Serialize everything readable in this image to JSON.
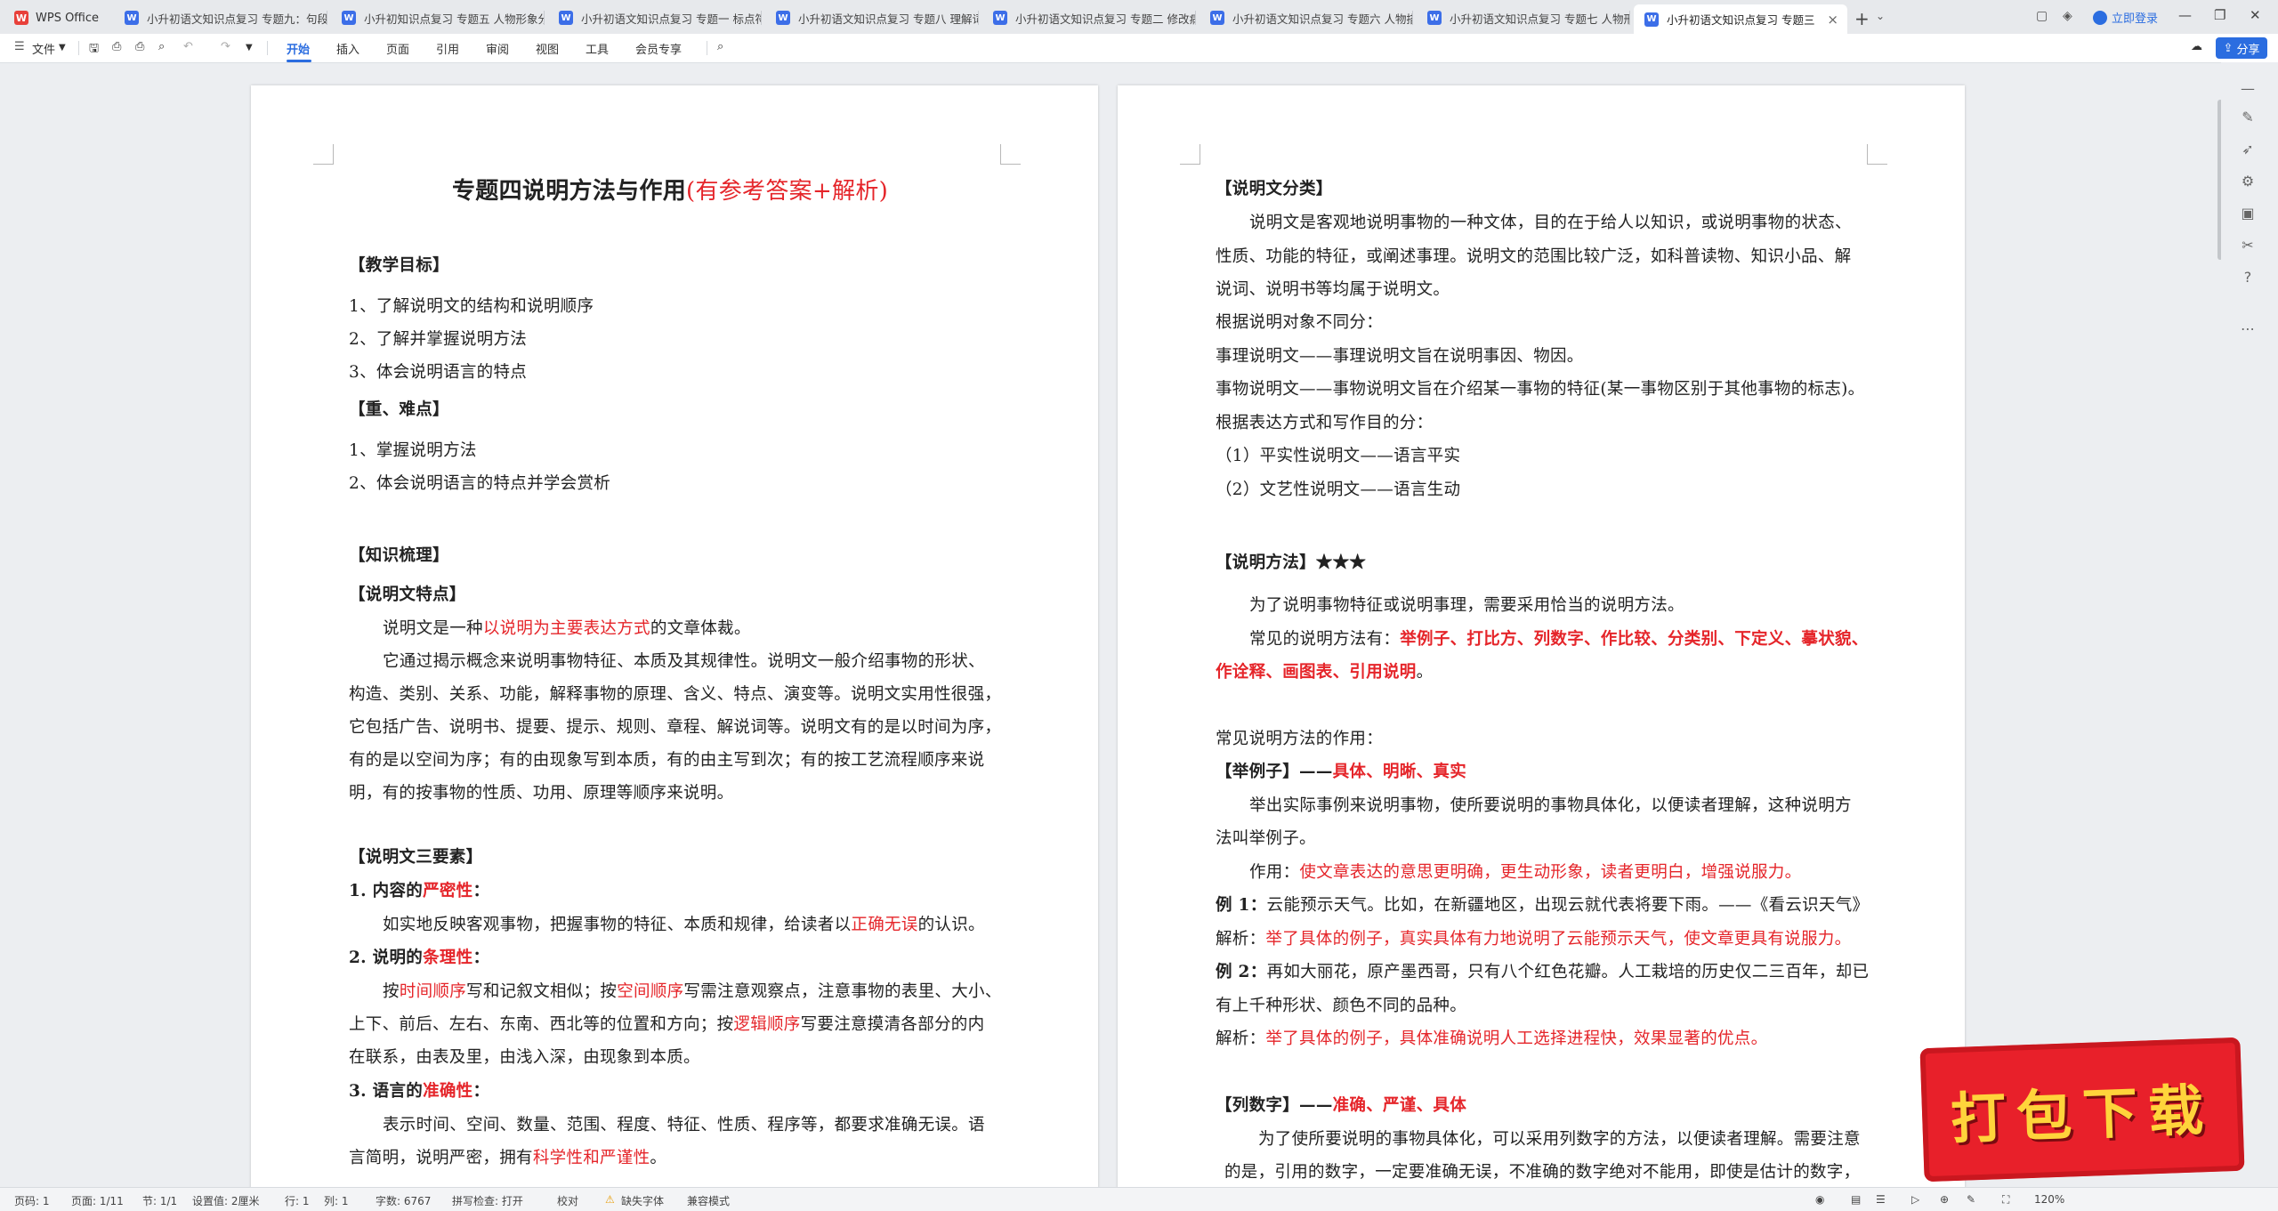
{
  "app": {
    "home_label": "WPS Office",
    "logo_letter": "W",
    "login_label": "立即登录",
    "share_label": "分享"
  },
  "tabs": [
    {
      "title": "小升初语文知识点复习 专题九：句段"
    },
    {
      "title": "小升初知识点复习 专题五 人物形象分析"
    },
    {
      "title": "小升初语文知识点复习 专题一 标点符号"
    },
    {
      "title": "小升初语文知识点复习 专题八 理解词语"
    },
    {
      "title": "小升初语文知识点复习 专题二 修改病句"
    },
    {
      "title": "小升初语文知识点复习 专题六 人物描写"
    },
    {
      "title": "小升初语文知识点复习 专题七 人物形象"
    },
    {
      "title": "小升初语文知识点复习 专题三"
    }
  ],
  "ribbon": {
    "file_label": "文件",
    "tabs": [
      "开始",
      "插入",
      "页面",
      "引用",
      "审阅",
      "视图",
      "工具",
      "会员专享"
    ]
  },
  "page1": {
    "title_main": "专题四说明方法与作用",
    "title_red": "(有参考答案+解析)",
    "goal_heading": "【教学目标】",
    "goals": [
      "1、了解说明文的结构和说明顺序",
      "2、了解并掌握说明方法",
      "3、体会说明语言的特点"
    ],
    "key_heading": "【重、难点】",
    "keys": [
      "1、掌握说明方法",
      "2、体会说明语言的特点并学会赏析"
    ],
    "knowledge_heading": "【知识梳理】",
    "feature_heading": "【说明文特点】",
    "feature_p1_a": "说明文是一种",
    "feature_p1_red": "以说明为主要表达方式",
    "feature_p1_b": "的文章体裁。",
    "feature_lines": [
      "它通过揭示概念来说明事物特征、本质及其规律性。说明文一般介绍事物的形状、",
      "构造、类别、关系、功能，解释事物的原理、含义、特点、演变等。说明文实用性很强，",
      "它包括广告、说明书、提要、提示、规则、章程、解说词等。说明文有的是以时间为序，",
      "有的是以空间为序；有的由现象写到本质，有的由主写到次；有的按工艺流程顺序来说",
      "明，有的按事物的性质、功用、原理等顺序来说明。"
    ],
    "three_heading": "【说明文三要素】",
    "r1_label": "1. 内容的",
    "r1_red": "严密性",
    "r1_colon": "：",
    "r1_text_a": "如实地反映客观事物，把握事物的特征、本质和规律，给读者以",
    "r1_text_red": "正确无误",
    "r1_text_b": "的认识。",
    "r2_label": "2. 说明的",
    "r2_red": "条理性",
    "r2_colon": "：",
    "r2_l1_a": "按",
    "r2_l1_r1": "时间顺序",
    "r2_l1_b": "写和记叙文相似；按",
    "r2_l1_r2": "空间顺序",
    "r2_l1_c": "写需注意观察点，注意事物的表里、大小、",
    "r2_l2_a": "上下、前后、左右、东南、西北等的位置和方向；按",
    "r2_l2_r": "逻辑顺序",
    "r2_l2_b": "写要注意摸清各部分的内",
    "r2_l3": "在联系，由表及里，由浅入深，由现象到本质。",
    "r3_label": "3. 语言的",
    "r3_red": "准确性",
    "r3_colon": "：",
    "r3_l1": "表示时间、空间、数量、范围、程度、特征、性质、程序等，都要求准确无误。语",
    "r3_l2_a": "言简明，说明严密，拥有",
    "r3_l2_red": "科学性和严谨性",
    "r3_l2_b": "。"
  },
  "page2": {
    "class_heading": "【说明文分类】",
    "class_lines": [
      "说明文是客观地说明事物的一种文体，目的在于给人以知识，或说明事物的状态、",
      "性质、功能的特征，或阐述事理。说明文的范围比较广泛，如科普读物、知识小品、解",
      "说词、说明书等均属于说明文。",
      "根据说明对象不同分：",
      "事理说明文——事理说明文旨在说明事因、物因。",
      "事物说明文——事物说明文旨在介绍某一事物的特征(某一事物区别于其他事物的标志)。",
      "根据表达方式和写作目的分：",
      "（1）平实性说明文——语言平实",
      "（2）文艺性说明文——语言生动"
    ],
    "method_heading": "【说明方法】★★★",
    "method_p1": "为了说明事物特征或说明事理，需要采用恰当的说明方法。",
    "method_p2_a": "常见的说明方法有：",
    "method_p2_red": "举例子、打比方、列数字、作比较、分类别、下定义、摹状貌、",
    "method_p3_red": "作诠释、画图表、引用说明",
    "method_p3_b": "。",
    "effect_heading": "常见说明方法的作用：",
    "eg_heading": "【举例子】",
    "eg_dash": "——",
    "eg_red": "具体、明晰、真实",
    "eg_l1": "举出实际事例来说明事物，使所要说明的事物具体化，以便读者理解，这种说明方",
    "eg_l2": "法叫举例子。",
    "eg_use_a": "作用：",
    "eg_use_red": "使文章表达的意思更明确，更生动形象，读者更明白，增强说服力。",
    "ex1_label": "例 1：",
    "ex1_text": "云能预示天气。比如，在新疆地区，出现云就代表将要下雨。——《看云识天气》",
    "ex1_ans_a": "解析：",
    "ex1_ans_red": "举了具体的例子，真实具体有力地说明了云能预示天气，使文章更具有说服力。",
    "ex2_label": "例 2：",
    "ex2_l1": "再如大丽花，原产墨西哥，只有八个红色花瓣。人工栽培的历史仅二三百年，却已",
    "ex2_l2": "有上千种形状、颜色不同的品种。",
    "ex2_ans_a": "解析：",
    "ex2_ans_red": "举了具体的例子，具体准确说明人工选择进程快，效果显著的优点。",
    "num_heading": "【列数字】",
    "num_dash": "——",
    "num_red": "准确、严谨、具体",
    "num_l1": "为了使所要说明的事物具体化，可以采用列数字的方法，以便读者理解。需要注意",
    "num_l2": "的是，引用的数字，一定要准确无误，不准确的数字绝对不能用，即使是估计的数字，"
  },
  "statusbar": {
    "page_num": "页码: 1",
    "page_of": "页面: 1/11",
    "section": "节: 1/1",
    "setting": "设置值: 2厘米",
    "row": "行: 1",
    "col": "列: 1",
    "words": "字数: 6767",
    "spell": "拼写检查: 打开",
    "proof": "校对",
    "missing_font": "缺失字体",
    "compat": "兼容模式",
    "zoom": "120%"
  },
  "download_banner": "打包下载",
  "colors": {
    "accent": "#2b6de0",
    "red_text": "#e5252a",
    "banner": "#e8202a"
  }
}
